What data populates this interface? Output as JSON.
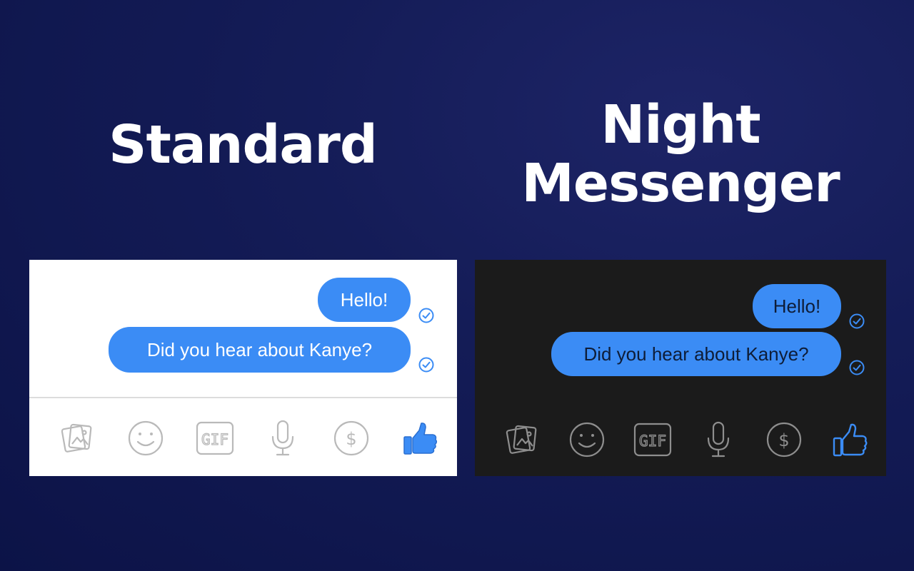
{
  "headings": {
    "standard": "Standard",
    "night_line1": "Night",
    "night_line2": "Messenger"
  },
  "conversation": {
    "message_1": "Hello!",
    "message_2": "Did you hear about Kanye?"
  },
  "status_icon": "sent-check-icon",
  "composer_icons": [
    "photo-icon",
    "emoji-icon",
    "gif-icon",
    "microphone-icon",
    "payment-icon",
    "like-icon"
  ],
  "gif_label": "GIF",
  "payment_label": "$",
  "colors": {
    "bubble": "#3b8cf5",
    "night_panel": "#1b1b1b",
    "standard_panel": "#ffffff",
    "background": "#141c57"
  }
}
